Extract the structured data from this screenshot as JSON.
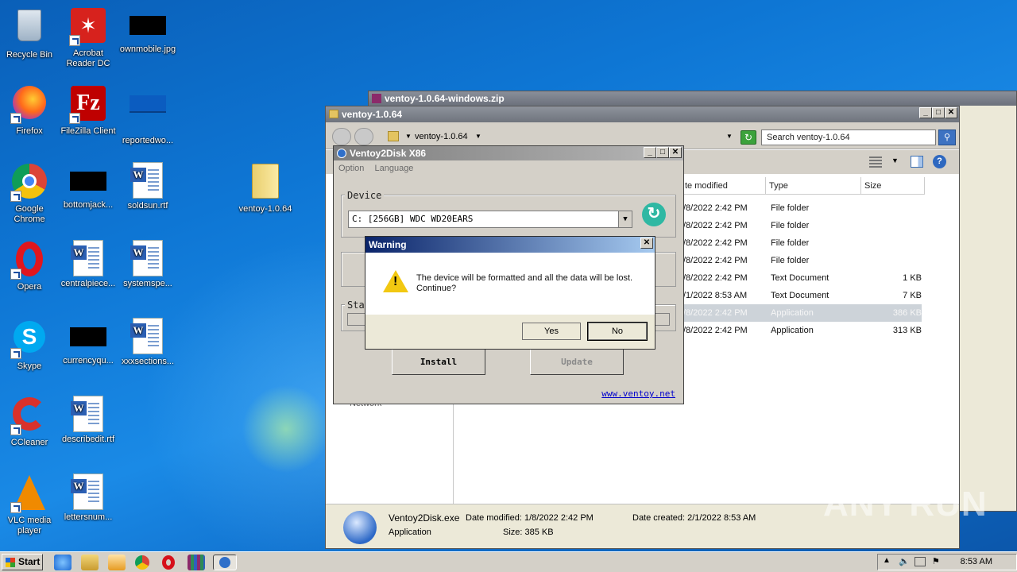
{
  "desktop": {
    "icons": [
      {
        "label": "Recycle Bin"
      },
      {
        "label": "Acrobat Reader DC"
      },
      {
        "label": "ownmobile.jpg"
      },
      {
        "label": "Firefox"
      },
      {
        "label": "FileZilla Client"
      },
      {
        "label": "reportedwo..."
      },
      {
        "label": "Google Chrome"
      },
      {
        "label": "bottomjack..."
      },
      {
        "label": "soldsun.rtf"
      },
      {
        "label": "ventoy-1.0.64"
      },
      {
        "label": "Opera"
      },
      {
        "label": "centralpiece..."
      },
      {
        "label": "systemspe..."
      },
      {
        "label": "Skype"
      },
      {
        "label": "currencyqu..."
      },
      {
        "label": "xxxsections..."
      },
      {
        "label": "CCleaner"
      },
      {
        "label": "describedit.rtf"
      },
      {
        "label": "VLC media player"
      },
      {
        "label": "lettersnum..."
      }
    ]
  },
  "zip_window": {
    "title": "ventoy-1.0.64-windows.zip"
  },
  "explorer": {
    "title": "ventoy-1.0.64",
    "address": "ventoy-1.0.64",
    "search_placeholder": "Search ventoy-1.0.64",
    "columns": {
      "date": "te modified",
      "type": "Type",
      "size": "Size"
    },
    "files": [
      {
        "date": "/8/2022 2:42 PM",
        "type": "File folder",
        "size": ""
      },
      {
        "date": "/8/2022 2:42 PM",
        "type": "File folder",
        "size": ""
      },
      {
        "date": "/8/2022 2:42 PM",
        "type": "File folder",
        "size": ""
      },
      {
        "date": "/8/2022 2:42 PM",
        "type": "File folder",
        "size": ""
      },
      {
        "date": "/8/2022 2:42 PM",
        "type": "Text Document",
        "size": "1 KB"
      },
      {
        "date": "/1/2022 8:53 AM",
        "type": "Text Document",
        "size": "7 KB"
      },
      {
        "date": "/8/2022 2:42 PM",
        "type": "Application",
        "size": "386 KB"
      },
      {
        "date": "/8/2022 2:42 PM",
        "type": "Application",
        "size": "313 KB"
      }
    ],
    "left_pane_item": "Network",
    "status": {
      "name": "Ventoy2Disk.exe",
      "date_modified": "Date modified: 1/8/2022 2:42 PM",
      "date_created": "Date created: 2/1/2022 8:53 AM",
      "type": "Application",
      "size": "Size: 385 KB"
    }
  },
  "ventoy": {
    "title": "Ventoy2Disk  X86",
    "menu": {
      "option": "Option",
      "language": "Language"
    },
    "device_label": "Device",
    "device_value": "C: [256GB]  WDC WD20EARS",
    "status_label": "Sta",
    "install_label": "Install",
    "update_label": "Update",
    "link": "www.ventoy.net"
  },
  "warning": {
    "title": "Warning",
    "line1": "The device will be formatted and all the data will be lost.",
    "line2": "Continue?",
    "yes": "Yes",
    "no": "No"
  },
  "taskbar": {
    "start": "Start",
    "clock": "8:53 AM"
  },
  "watermark": "ANY RUN"
}
